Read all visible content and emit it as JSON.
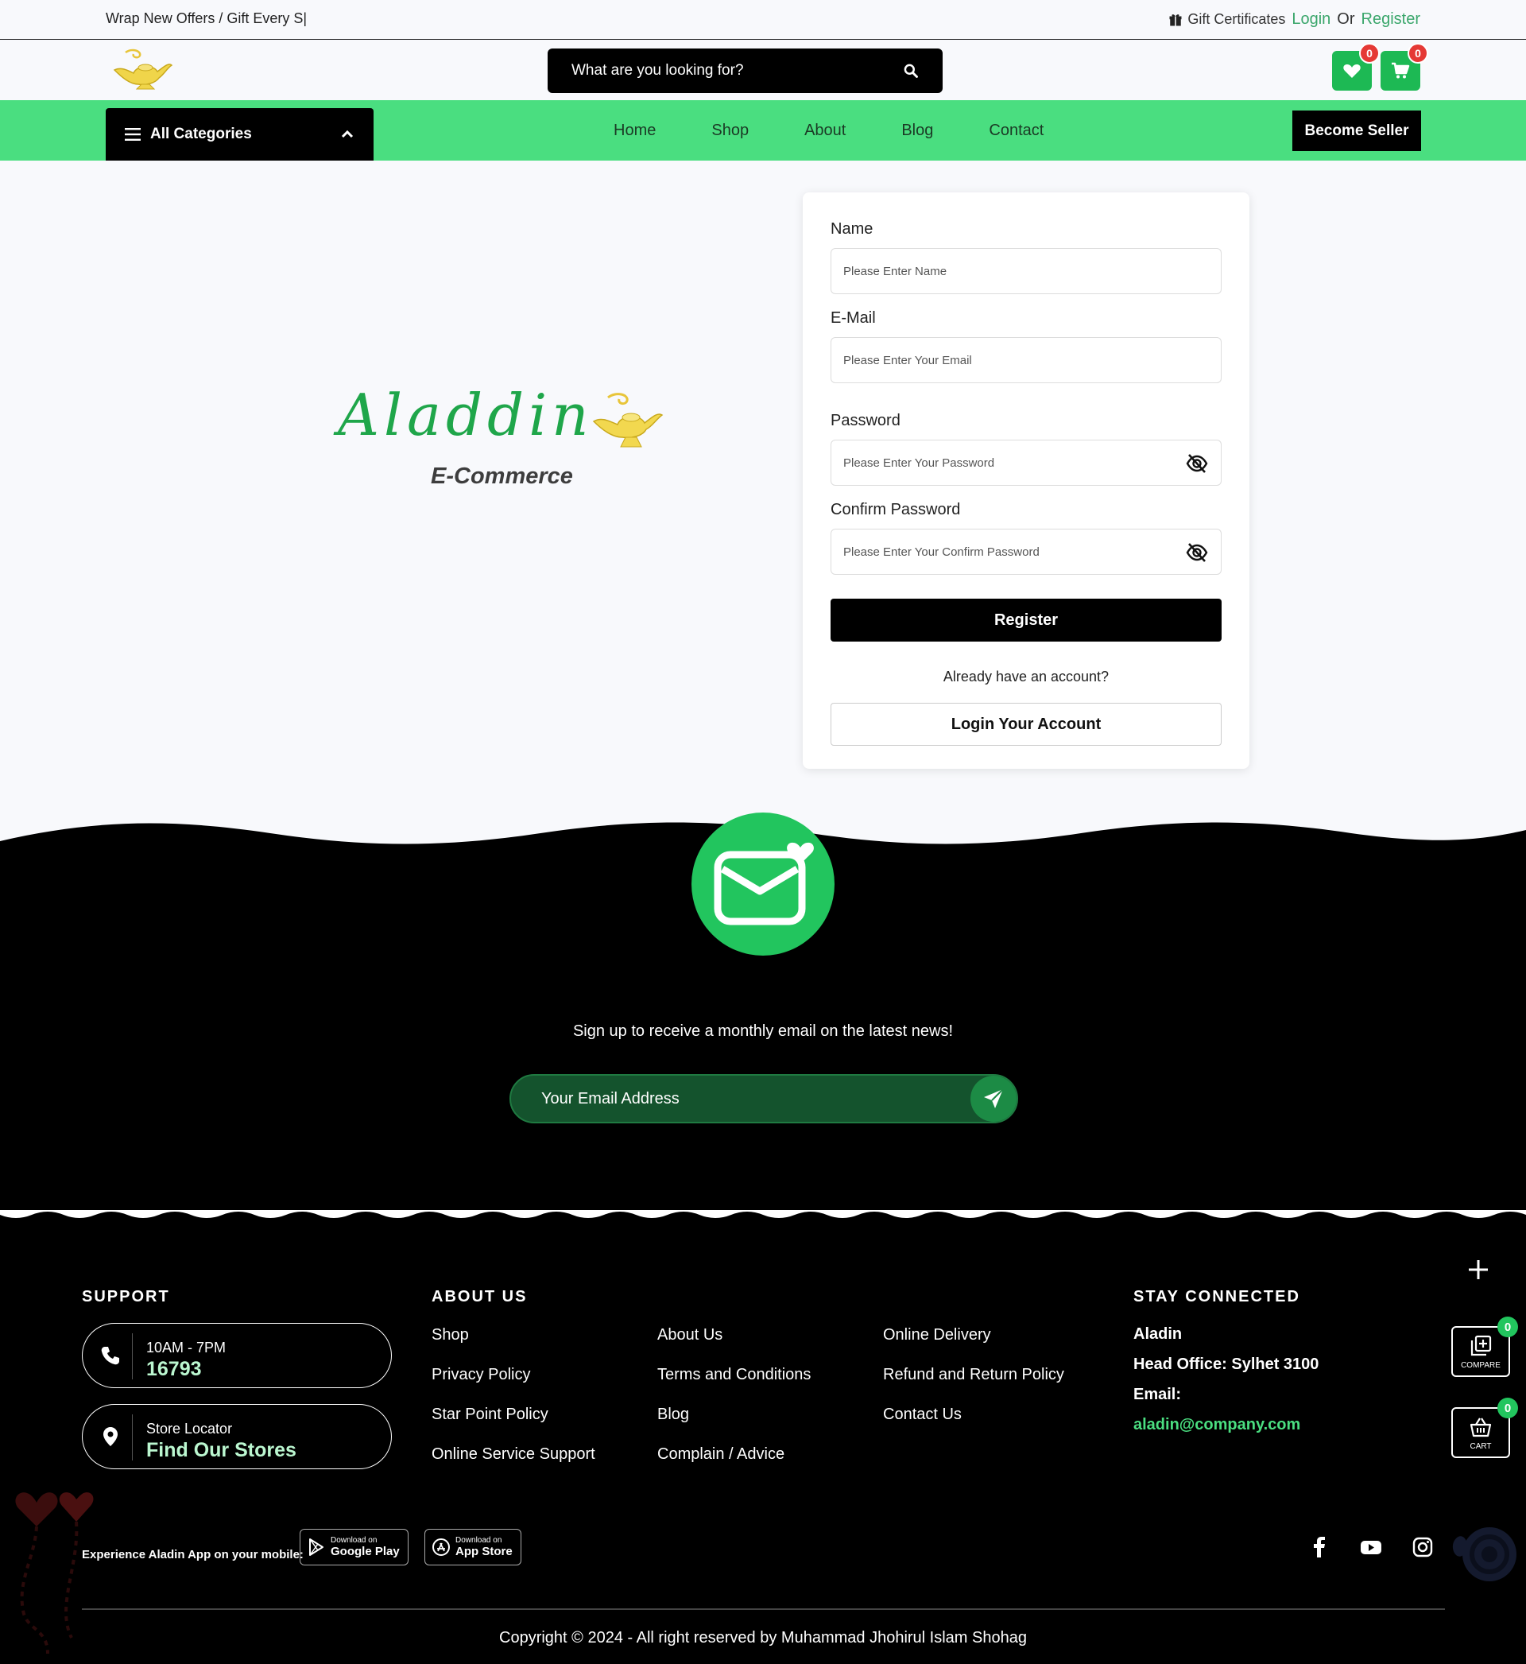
{
  "topbar": {
    "promo": "Wrap New Offers / Gift Every S|",
    "gift_label": "Gift Certificates",
    "login": "Login",
    "or": "Or",
    "register": "Register"
  },
  "header": {
    "search_placeholder": "What are you looking for?",
    "wishlist_count": "0",
    "cart_count": "0"
  },
  "nav": {
    "categories_label": "All Categories",
    "items": [
      "Home",
      "Shop",
      "About",
      "Blog",
      "Contact"
    ],
    "seller_button": "Become Seller"
  },
  "brand": {
    "name": "Aladdin",
    "subtitle": "E-Commerce"
  },
  "form": {
    "name_label": "Name",
    "name_placeholder": "Please Enter Name",
    "email_label": "E-Mail",
    "email_placeholder": "Please Enter Your Email",
    "password_label": "Password",
    "password_placeholder": "Please Enter Your Password",
    "confirm_label": "Confirm Password",
    "confirm_placeholder": "Please Enter Your Confirm Password",
    "register_button": "Register",
    "have_account": "Already have an account?",
    "login_button": "Login Your Account"
  },
  "newsletter": {
    "text": "Sign up to receive a monthly email on the latest news!",
    "placeholder": "Your Email Address"
  },
  "footer": {
    "support_heading": "SUPPORT",
    "hours": "10AM - 7PM",
    "phone": "16793",
    "locator_label": "Store Locator",
    "locator_link": "Find Our Stores",
    "about_heading": "ABOUT US",
    "col1": [
      "Shop",
      "Privacy Policy",
      "Star Point Policy",
      "Online Service Support"
    ],
    "col2": [
      "About Us",
      "Terms and Conditions",
      "Blog",
      "Complain / Advice"
    ],
    "col3": [
      "Online Delivery",
      "Refund and Return Policy",
      "Contact Us"
    ],
    "stay_heading": "STAY CONNECTED",
    "company": "Aladin",
    "office": "Head Office: Sylhet 3100",
    "email_label": "Email:",
    "email": "aladin@company.com",
    "compare_label": "COMPARE",
    "compare_count": "0",
    "cart_label": "CART",
    "cart_count": "0",
    "app_text": "Experience Aladin App on your mobile:",
    "google_top": "Download on",
    "google_name": "Google Play",
    "apple_top": "Download on",
    "apple_name": "App Store",
    "copyright": "Copyright © 2024 - All right reserved by Muhammad Jhohirul Islam Shohag"
  },
  "colors": {
    "accent_green": "#4ade80",
    "button_green": "#1db954",
    "badge_red": "#e53935",
    "link_green": "#3aa66b"
  },
  "icons": [
    "gift-icon",
    "search-icon",
    "heart-icon",
    "cart-icon",
    "menu-icon",
    "chevron-up-icon",
    "eye-slash-icon",
    "mail-icon",
    "send-icon",
    "phone-icon",
    "location-icon",
    "plus-icon",
    "compare-icon",
    "basket-icon",
    "google-play-icon",
    "app-store-icon",
    "facebook-icon",
    "youtube-icon",
    "instagram-icon"
  ]
}
